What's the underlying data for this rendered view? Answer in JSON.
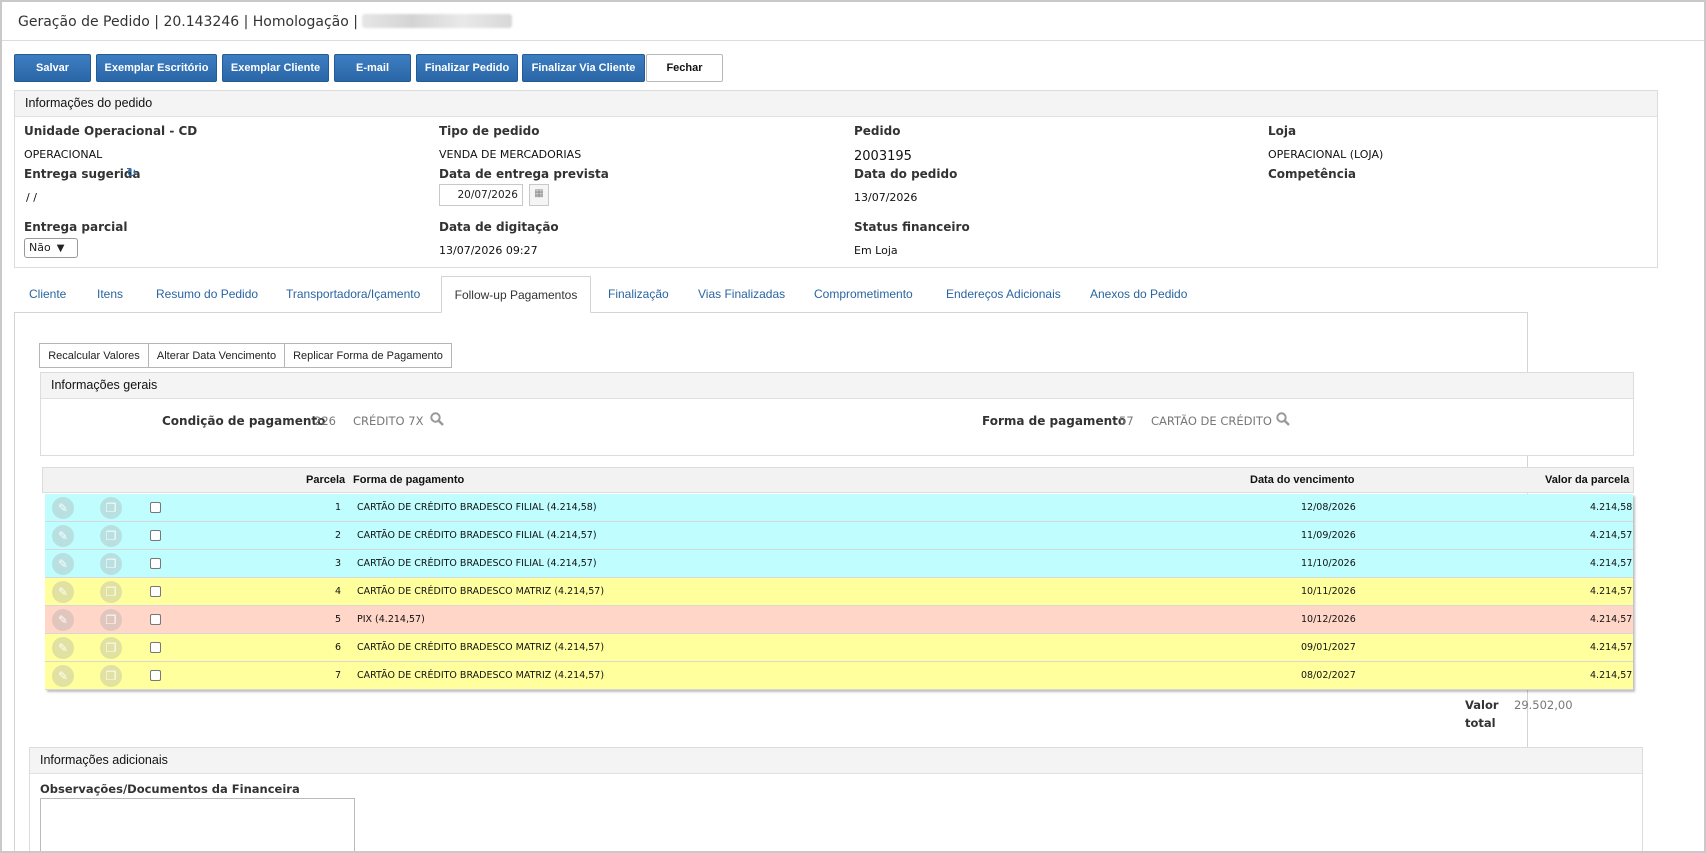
{
  "window": {
    "title": "Geração de Pedido | 20.143246 | Homologação |"
  },
  "toolbar": {
    "buttons": [
      "Salvar",
      "Exemplar Escritório",
      "Exemplar Cliente",
      "E-mail",
      "Finalizar Pedido",
      "Finalizar Via Cliente",
      "Fechar"
    ]
  },
  "order_info": {
    "header": "Informações do pedido",
    "unidade_label": "Unidade Operacional - CD",
    "unidade_value": "OPERACIONAL",
    "tipo_label": "Tipo de pedido",
    "tipo_value": "VENDA DE MERCADORIAS",
    "pedido_label": "Pedido",
    "pedido_value": "2003195",
    "loja_label": "Loja",
    "loja_value": "OPERACIONAL (LOJA)",
    "entrega_sugerida_label": "Entrega sugerida",
    "entrega_sugerida_value": "/ /",
    "data_entrega_label": "Data de entrega prevista",
    "data_entrega_value": "20/07/2026",
    "data_pedido_label": "Data do pedido",
    "data_pedido_value": "13/07/2026",
    "competencia_label": "Competência",
    "entrega_parcial_label": "Entrega parcial",
    "entrega_parcial_value": "Não",
    "data_digitacao_label": "Data de digitação",
    "data_digitacao_value": "13/07/2026 09:27",
    "status_label": "Status financeiro",
    "status_value": "Em Loja"
  },
  "tabs": [
    "Cliente",
    "Itens",
    "Resumo do Pedido",
    "Transportadora/Içamento",
    "Follow-up Pagamentos",
    "Finalização",
    "Vias Finalizadas",
    "Comprometimento",
    "Endereços Adicionais",
    "Anexos do Pedido"
  ],
  "active_tab": "Follow-up Pagamentos",
  "sub_buttons": [
    "Recalcular Valores",
    "Alterar Data Vencimento",
    "Replicar Forma de Pagamento"
  ],
  "general": {
    "header": "Informações gerais",
    "condicao_label": "Condição de pagamento",
    "condicao_code": "226",
    "condicao_desc": "CRÉDITO 7X",
    "forma_label": "Forma de pagamento",
    "forma_code": "57",
    "forma_desc": "CARTÃO DE CRÉDITO"
  },
  "grid": {
    "headers": {
      "parcela": "Parcela",
      "forma": "Forma de pagamento",
      "vencimento": "Data do vencimento",
      "valor": "Valor da parcela"
    },
    "rows": [
      {
        "parcela": "1",
        "forma": "CARTÃO DE CRÉDITO BRADESCO FILIAL (4.214,58)",
        "vencimento": "12/08/2026",
        "valor": "4.214,58",
        "color": "#c0fdff"
      },
      {
        "parcela": "2",
        "forma": "CARTÃO DE CRÉDITO BRADESCO FILIAL (4.214,57)",
        "vencimento": "11/09/2026",
        "valor": "4.214,57",
        "color": "#c0fdff"
      },
      {
        "parcela": "3",
        "forma": "CARTÃO DE CRÉDITO BRADESCO FILIAL (4.214,57)",
        "vencimento": "11/10/2026",
        "valor": "4.214,57",
        "color": "#c0fdff"
      },
      {
        "parcela": "4",
        "forma": "CARTÃO DE CRÉDITO BRADESCO MATRIZ (4.214,57)",
        "vencimento": "10/11/2026",
        "valor": "4.214,57",
        "color": "#ffff9e"
      },
      {
        "parcela": "5",
        "forma": "PIX (4.214,57)",
        "vencimento": "10/12/2026",
        "valor": "4.214,57",
        "color": "#ffd6c8"
      },
      {
        "parcela": "6",
        "forma": "CARTÃO DE CRÉDITO BRADESCO MATRIZ (4.214,57)",
        "vencimento": "09/01/2027",
        "valor": "4.214,57",
        "color": "#ffff9e"
      },
      {
        "parcela": "7",
        "forma": "CARTÃO DE CRÉDITO BRADESCO MATRIZ (4.214,57)",
        "vencimento": "08/02/2027",
        "valor": "4.214,57",
        "color": "#ffff9e"
      }
    ]
  },
  "total": {
    "label_line1": "Valor",
    "label_line2": "total",
    "value": "29.502,00"
  },
  "additional": {
    "header": "Informações adicionais",
    "obs_label": "Observações/Documentos da Financeira"
  },
  "icons": {
    "edit": "pencil-icon",
    "copy": "document-icon",
    "search": "search-icon",
    "refresh": "refresh-icon",
    "calendar": "calendar-icon"
  }
}
